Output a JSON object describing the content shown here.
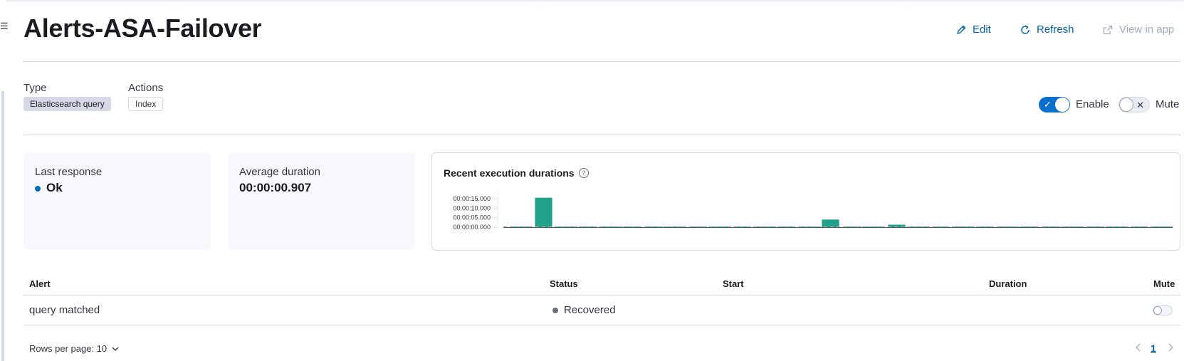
{
  "header": {
    "title": "Alerts-ASA-Failover",
    "edit_label": "Edit",
    "refresh_label": "Refresh",
    "view_in_app_label": "View in app"
  },
  "details": {
    "type_label": "Type",
    "type_value": "Elasticsearch query",
    "actions_label": "Actions",
    "actions_value": "Index",
    "enable_label": "Enable",
    "enable_on": true,
    "mute_label": "Mute",
    "mute_on": false
  },
  "stats": {
    "last_response_label": "Last response",
    "last_response_value": "Ok",
    "last_response_color": "#006bb8",
    "avg_duration_label": "Average duration",
    "avg_duration_value": "00:00:00.907"
  },
  "chart_data": {
    "type": "bar",
    "title": "Recent execution durations",
    "y_ticks": [
      "00:00:15.000",
      "00:00:10.000",
      "00:00:05.000",
      "00:00:00.000"
    ],
    "ylim": [
      0,
      15
    ],
    "y_unit": "seconds",
    "bar_color": "#21a08a",
    "threshold_color": "#e58aa0",
    "values": [
      0.3,
      15.5,
      0.3,
      0.3,
      0.3,
      0.3,
      0.3,
      0.3,
      0.3,
      0.3,
      0.3,
      0.3,
      0.3,
      0.3,
      4.0,
      0.3,
      0.3,
      1.3,
      0.3,
      0.3,
      0.3,
      0.3,
      0.3,
      0.3,
      0.3,
      0.3,
      0.3,
      0.3,
      0.3,
      0.3
    ]
  },
  "table": {
    "headers": {
      "alert": "Alert",
      "status": "Status",
      "start": "Start",
      "duration": "Duration",
      "mute": "Mute"
    },
    "rows": [
      {
        "alert": "query matched",
        "status": "Recovered",
        "status_color": "#69707d",
        "start": "",
        "duration": "",
        "muted": false
      }
    ]
  },
  "footer": {
    "rows_per_page": "Rows per page: 10",
    "current_page": "1"
  }
}
